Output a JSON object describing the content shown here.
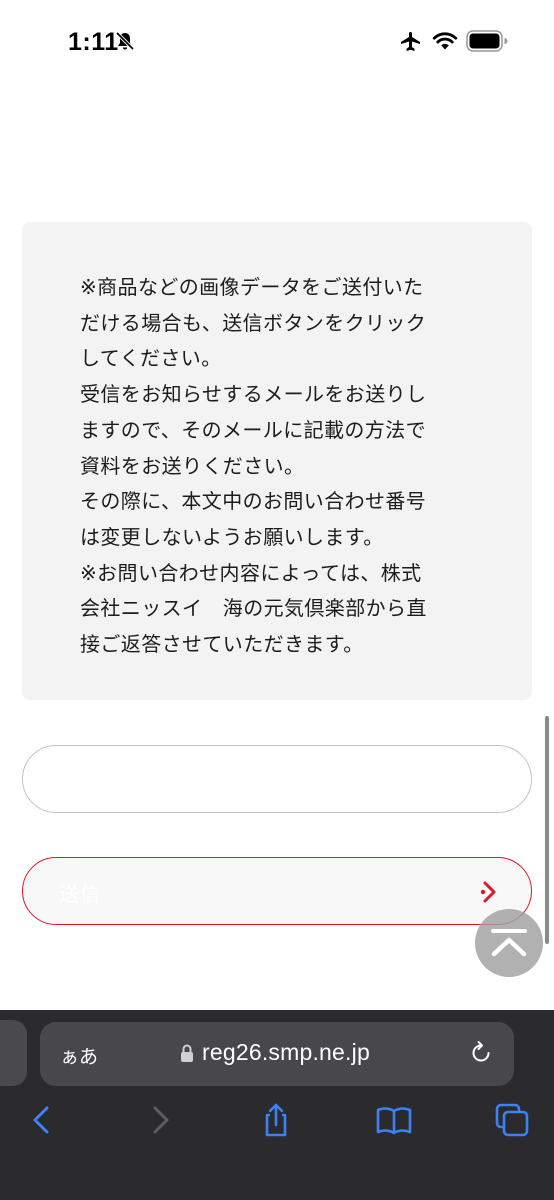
{
  "status_bar": {
    "time": "1:11"
  },
  "info_box": {
    "lines": [
      "※商品などの画像データをご送付いた",
      "だける場合も、送信ボタンをクリック",
      "してください。",
      "受信をお知らせするメールをお送りし",
      "ますので、そのメールに記載の方法で",
      "資料をお送りください。",
      "その際に、本文中のお問い合わせ番号",
      "は変更しないようお願いします。",
      "※お問い合わせ内容によっては、株式",
      "会社ニッスイ　海の元気倶楽部から直",
      "接ご返答させていただきます。"
    ]
  },
  "form": {
    "text_field_value": "",
    "submit_label": "送信"
  },
  "safari": {
    "aa_label": "ぁあ",
    "url": "reg26.smp.ne.jp"
  },
  "colors": {
    "accent_red": "#d9192b",
    "safari_blue": "#3b82f6"
  },
  "icons": [
    "mute-icon",
    "airplane-icon",
    "wifi-icon",
    "battery-icon",
    "chevron-right-icon",
    "chevron-up-icon",
    "lock-icon",
    "reload-icon",
    "back-icon",
    "forward-icon",
    "share-icon",
    "bookmarks-icon",
    "tabs-icon"
  ]
}
